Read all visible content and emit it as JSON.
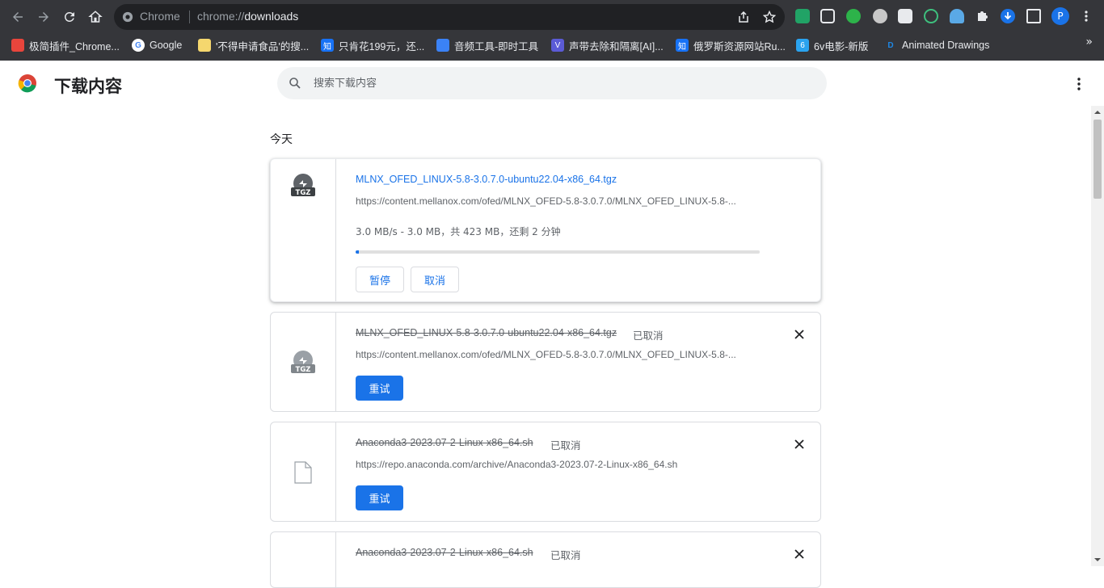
{
  "browser": {
    "omnibox": {
      "brand": "Chrome",
      "url_scheme": "chrome://",
      "url_host": "downloads"
    },
    "bookmarks": [
      {
        "label": "极简插件_Chrome...",
        "color": "#e8453c"
      },
      {
        "label": "Google",
        "color": "#4285f4"
      },
      {
        "label": "'不得申请食品'的搜...",
        "color": "#f5d76e"
      },
      {
        "label": "只肯花199元，还...",
        "color": "#1772f6"
      },
      {
        "label": "音频工具-即时工具",
        "color": "#3b82f6"
      },
      {
        "label": "声带去除和隔离[AI]...",
        "color": "#5b5bd6"
      },
      {
        "label": "俄罗斯资源网站Ru...",
        "color": "#1772f6"
      },
      {
        "label": "6v电影-新版",
        "color": "#2aa3ef"
      },
      {
        "label": "Animated Drawings",
        "color": "#1e88e5"
      }
    ]
  },
  "page": {
    "title": "下载内容",
    "search_placeholder": "搜索下载内容",
    "section_label": "今天"
  },
  "downloads": [
    {
      "filename": "MLNX_OFED_LINUX-5.8-3.0.7.0-ubuntu22.04-x86_64.tgz",
      "url": "https://content.mellanox.com/ofed/MLNX_OFED-5.8-3.0.7.0/MLNX_OFED_LINUX-5.8-...",
      "progress_text": "3.0 MB/s - 3.0 MB，共 423 MB，还剩 2 分钟",
      "progress_fraction": 0.007,
      "icon_label": "TGZ",
      "pause_label": "暂停",
      "cancel_label": "取消"
    },
    {
      "filename": "MLNX_OFED_LINUX-5.8-3.0.7.0-ubuntu22.04-x86_64.tgz",
      "status": "已取消",
      "url": "https://content.mellanox.com/ofed/MLNX_OFED-5.8-3.0.7.0/MLNX_OFED_LINUX-5.8-...",
      "icon_label": "TGZ",
      "retry_label": "重试"
    },
    {
      "filename": "Anaconda3-2023.07-2-Linux-x86_64.sh",
      "status": "已取消",
      "url": "https://repo.anaconda.com/archive/Anaconda3-2023.07-2-Linux-x86_64.sh",
      "retry_label": "重试"
    },
    {
      "filename": "Anaconda3-2023.07-2-Linux-x86_64.sh",
      "status": "已取消"
    }
  ],
  "colors": {
    "accent": "#1a73e8",
    "chrome_dark": "#35363a"
  }
}
